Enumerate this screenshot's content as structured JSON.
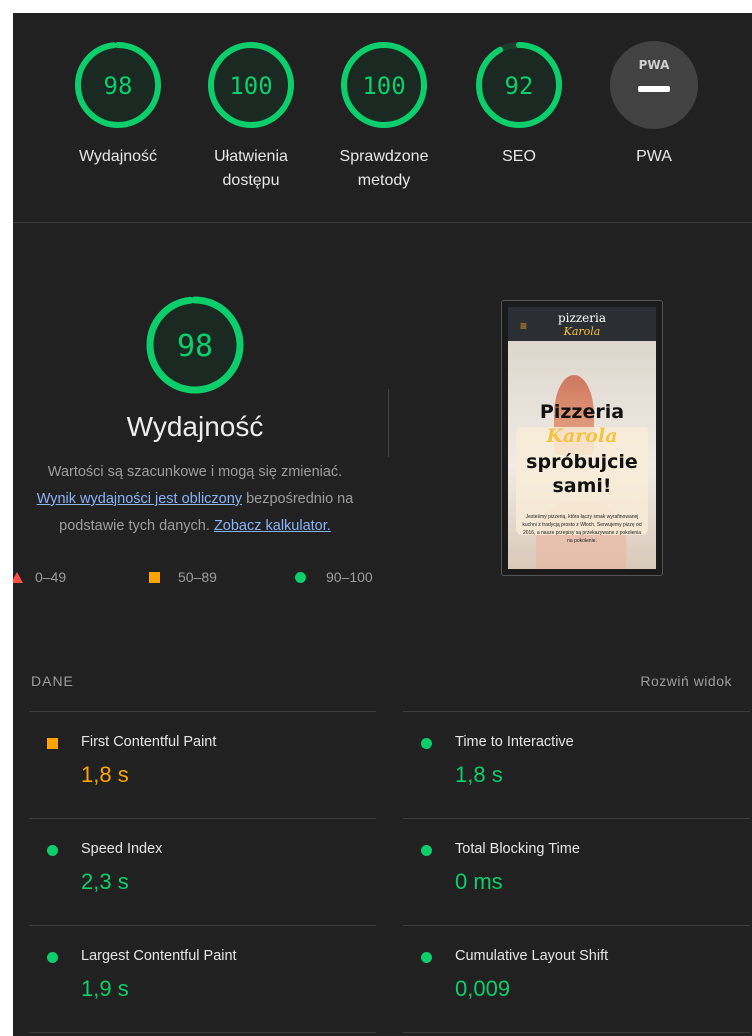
{
  "gauges": [
    {
      "value": "98",
      "label": "Wydajność",
      "score": 0.98
    },
    {
      "value": "100",
      "label": "Ułatwienia dostępu",
      "score": 1.0
    },
    {
      "value": "100",
      "label": "Sprawdzone metody",
      "score": 1.0
    },
    {
      "value": "92",
      "label": "SEO",
      "score": 0.92
    },
    {
      "value": "PWA",
      "label": "PWA"
    }
  ],
  "performance": {
    "score": "98",
    "score_fraction": 0.98,
    "title": "Wydajność",
    "desc_line1": "Wartości są szacunkowe i mogą się zmieniać.",
    "desc_link1": "Wynik wydajności jest obliczony",
    "desc_mid": " bezpośrednio na podstawie tych danych. ",
    "desc_link2": "Zobacz kalkulator."
  },
  "legend": {
    "fail": "0–49",
    "average": "50–89",
    "pass": "90–100"
  },
  "thumbnail": {
    "menu_icon": "≡",
    "brand_top": "pizzeria",
    "brand_bottom": "Karola",
    "hero_line1": "Pizzeria",
    "hero_line2": "Karola",
    "hero_line3": "spróbujcie",
    "hero_line4": "sami!",
    "small_text": "Jesteśmy pizzerią, która łączy smak wyrafinowanej kuchni z tradycją prosto z Włoch. Serwujemy pizzę od 2016, a nasze przepisy są przekazywane z pokolenia na pokolenie."
  },
  "metrics_section": {
    "heading": "DANE",
    "expand_label": "Rozwiń widok"
  },
  "metrics_left": [
    {
      "name": "First Contentful Paint",
      "value": "1,8 s",
      "status": "average"
    },
    {
      "name": "Speed Index",
      "value": "2,3 s",
      "status": "pass"
    },
    {
      "name": "Largest Contentful Paint",
      "value": "1,9 s",
      "status": "pass"
    }
  ],
  "metrics_right": [
    {
      "name": "Time to Interactive",
      "value": "1,8 s",
      "status": "pass"
    },
    {
      "name": "Total Blocking Time",
      "value": "0 ms",
      "status": "pass"
    },
    {
      "name": "Cumulative Layout Shift",
      "value": "0,009",
      "status": "pass"
    }
  ],
  "colors": {
    "pass": "#0cce6b",
    "average": "#ffa400",
    "fail": "#ff4e42",
    "panel_bg": "#212121"
  }
}
